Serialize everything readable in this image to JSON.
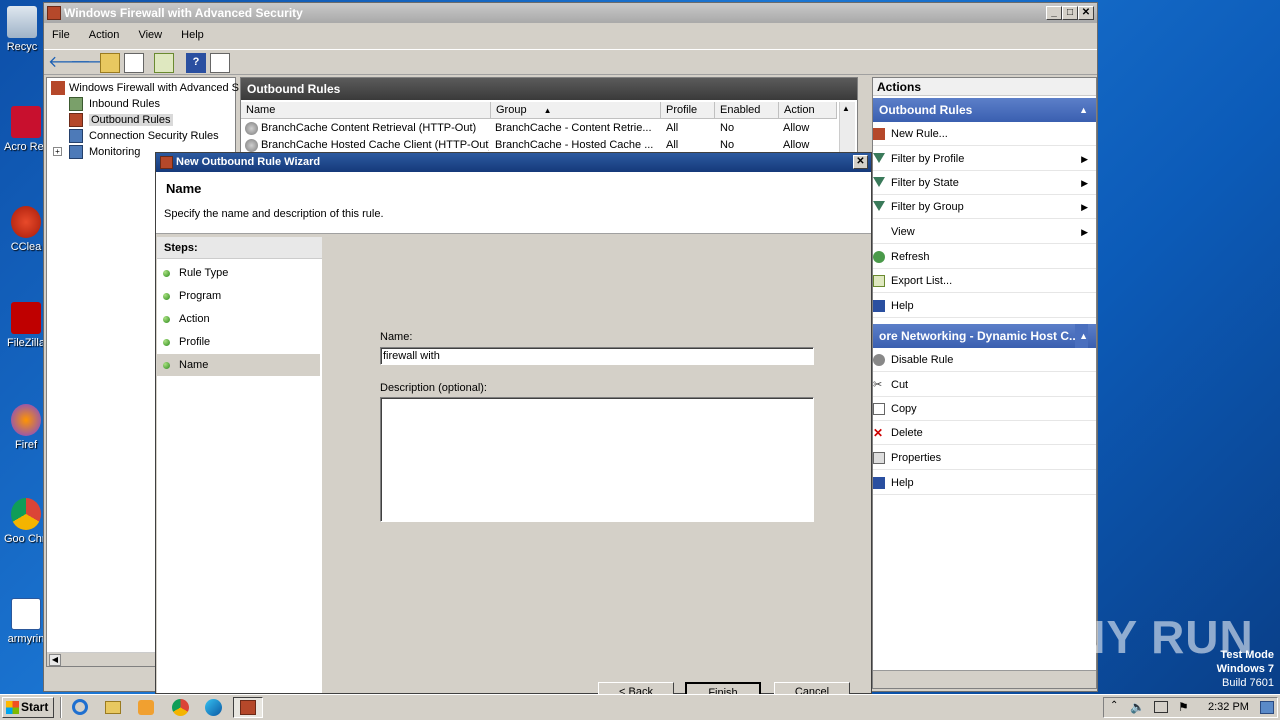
{
  "window": {
    "title": "Windows Firewall with Advanced Security"
  },
  "menu": {
    "items": [
      "File",
      "Action",
      "View",
      "Help"
    ]
  },
  "tree": {
    "root": "Windows Firewall with Advanced S",
    "items": [
      "Inbound Rules",
      "Outbound Rules",
      "Connection Security Rules",
      "Monitoring"
    ],
    "selected": "Outbound Rules"
  },
  "list": {
    "header": "Outbound Rules",
    "columns": [
      "Name",
      "Group",
      "Profile",
      "Enabled",
      "Action"
    ],
    "rows": [
      {
        "name": "BranchCache Content Retrieval (HTTP-Out)",
        "group": "BranchCache - Content Retrie...",
        "profile": "All",
        "enabled": "No",
        "action": "Allow"
      },
      {
        "name": "BranchCache Hosted Cache Client (HTTP-Out)",
        "group": "BranchCache - Hosted Cache ...",
        "profile": "All",
        "enabled": "No",
        "action": "Allow"
      }
    ]
  },
  "actions": {
    "title": "Actions",
    "section1": "Outbound Rules",
    "items1": [
      {
        "label": "New Rule...",
        "arrow": ""
      },
      {
        "label": "Filter by Profile",
        "arrow": "▶"
      },
      {
        "label": "Filter by State",
        "arrow": "▶"
      },
      {
        "label": "Filter by Group",
        "arrow": "▶"
      },
      {
        "label": "View",
        "arrow": "▶"
      },
      {
        "label": "Refresh",
        "arrow": ""
      },
      {
        "label": "Export List...",
        "arrow": ""
      },
      {
        "label": "Help",
        "arrow": ""
      }
    ],
    "section2": "ore Networking - Dynamic Host C...",
    "items2": [
      "Disable Rule",
      "Cut",
      "Copy",
      "Delete",
      "Properties",
      "Help"
    ]
  },
  "dialog": {
    "title": "New Outbound Rule Wizard",
    "heading": "Name",
    "subheading": "Specify the name and description of this rule.",
    "steps_title": "Steps:",
    "steps": [
      "Rule Type",
      "Program",
      "Action",
      "Profile",
      "Name"
    ],
    "active_step": "Name",
    "name_label": "Name:",
    "name_value": "firewall with",
    "desc_label": "Description (optional):",
    "desc_value": "",
    "buttons": {
      "back": "< Back",
      "finish": "Finish",
      "cancel": "Cancel"
    }
  },
  "desktop": {
    "icons": [
      "Recyc",
      "Acro Reade",
      "CClea",
      "FileZilla",
      "Firef",
      "Goo Chro",
      "armyrin"
    ]
  },
  "taskbar": {
    "start": "Start",
    "time": "2:32 PM"
  },
  "overlay": {
    "watermark": "ANY RUN",
    "testmode": [
      "Test Mode",
      "Windows 7",
      "Build 7601"
    ]
  }
}
